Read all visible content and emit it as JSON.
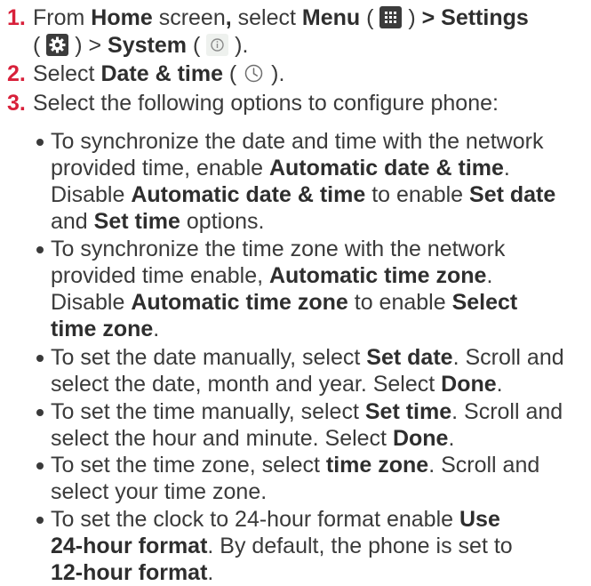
{
  "steps": [
    {
      "num": "1.",
      "t1": "From ",
      "b1": "Home",
      "t2": " screen",
      "b2": ",",
      "t3": " select ",
      "b3": "Menu",
      "t4": " ( ",
      "t5": " ) ",
      "b4": "> Settings",
      "t6": "( ",
      "t7": " ) > ",
      "b5": "System",
      "t8": " ( ",
      "t9": " )."
    },
    {
      "num": "2.",
      "t1": "Select ",
      "b1": "Date & time",
      "t2": " ( ",
      "t3": " )."
    },
    {
      "num": "3.",
      "t1": "Select the following options to configure phone:"
    }
  ],
  "icons": {
    "menu": "grid-icon",
    "settings": "gear-icon",
    "system": "info-icon",
    "datetime": "clock-icon"
  },
  "bullets": [
    {
      "l1": "To synchronize the date and time with the network",
      "l2a": "provided time, enable ",
      "l2b": "Automatic date & time",
      "l2c": ".",
      "l3a": "Disable ",
      "l3b": "Automatic date & time",
      "l3c": " to enable ",
      "l3d": "Set date",
      "l4a": "and ",
      "l4b": "Set time",
      "l4c": " options."
    },
    {
      "l1": "To synchronize the time zone with the network",
      "l2a": "provided time enable, ",
      "l2b": "Automatic time zone",
      "l2c": ".",
      "l3a": "Disable ",
      "l3b": "Automatic time zone",
      "l3c": " to enable ",
      "l3d": "Select",
      "l4a": "time zone",
      "l4b": "."
    },
    {
      "l1a": "To set the date manually, select ",
      "l1b": "Set date",
      "l1c": ". Scroll and",
      "l2a": "select the date, month and year. Select ",
      "l2b": "Done",
      "l2c": "."
    },
    {
      "l1a": "To set the time manually, select ",
      "l1b": "Set time",
      "l1c": ". Scroll and",
      "l2a": "select the hour and minute. Select ",
      "l2b": "Done",
      "l2c": "."
    },
    {
      "l1a": "To set the time zone, select ",
      "l1b": "time zone",
      "l1c": ". Scroll and",
      "l2": "select your time zone."
    },
    {
      "l1a": " To set the clock to 24-hour format enable ",
      "l1b": "Use",
      "l2a": "24-hour format",
      "l2b": ". By default, the phone is set to",
      "l3a": "12-hour format",
      "l3b": "."
    }
  ]
}
